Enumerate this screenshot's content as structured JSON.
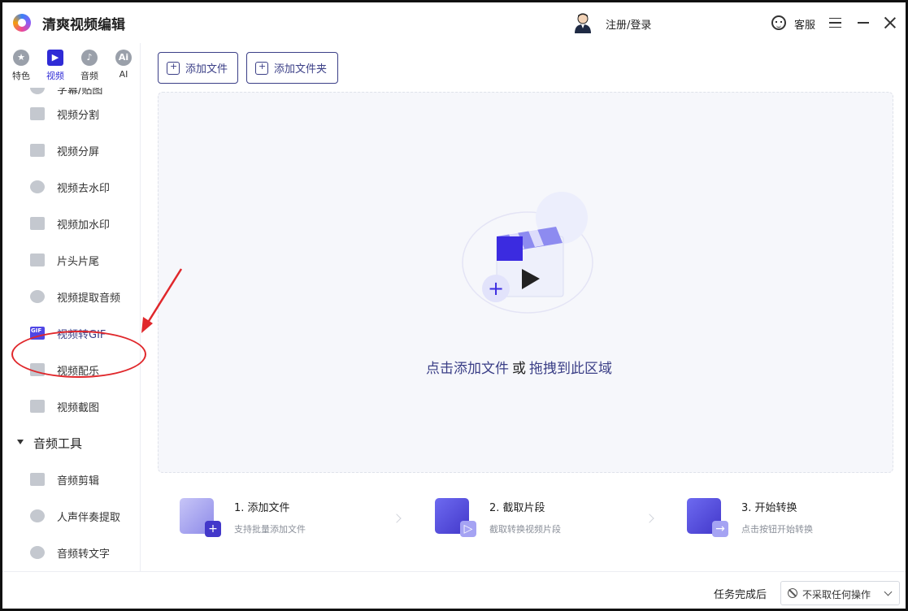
{
  "app": {
    "title": "清爽视频编辑"
  },
  "header": {
    "login_label": "注册/登录",
    "service_label": "客服"
  },
  "category_tabs": [
    {
      "label": "特色",
      "icon": "star-icon",
      "active": false
    },
    {
      "label": "视频",
      "icon": "film-icon",
      "active": true
    },
    {
      "label": "音频",
      "icon": "music-icon",
      "active": false
    },
    {
      "label": "AI",
      "icon": "ai-icon",
      "active": false
    }
  ],
  "tools": [
    {
      "label": "字幕/贴图",
      "icon": "subtitle-icon"
    },
    {
      "label": "视频分割",
      "icon": "split-icon"
    },
    {
      "label": "视频分屏",
      "icon": "split-screen-icon"
    },
    {
      "label": "视频去水印",
      "icon": "remove-watermark-icon"
    },
    {
      "label": "视频加水印",
      "icon": "add-watermark-icon"
    },
    {
      "label": "片头片尾",
      "icon": "intro-outro-icon"
    },
    {
      "label": "视频提取音频",
      "icon": "extract-audio-icon"
    },
    {
      "label": "视频转GIF",
      "icon": "gif-icon"
    },
    {
      "label": "视频配乐",
      "icon": "background-music-icon"
    },
    {
      "label": "视频截图",
      "icon": "screenshot-icon"
    }
  ],
  "audio_section": {
    "title": "音频工具",
    "items": [
      {
        "label": "音频剪辑",
        "icon": "audio-cut-icon"
      },
      {
        "label": "人声伴奏提取",
        "icon": "vocal-extract-icon"
      },
      {
        "label": "音频转文字",
        "icon": "speech-to-text-icon"
      }
    ]
  },
  "toolbar": {
    "add_file_label": "添加文件",
    "add_folder_label": "添加文件夹"
  },
  "dropzone": {
    "hint_add": "点击添加文件",
    "hint_or": "或",
    "hint_drag": "拖拽到此区域"
  },
  "steps": [
    {
      "title": "1. 添加文件",
      "desc": "支持批量添加文件"
    },
    {
      "title": "2. 截取片段",
      "desc": "截取转换视频片段"
    },
    {
      "title": "3. 开始转换",
      "desc": "点击按钮开始转换"
    }
  ],
  "bottom": {
    "task_label": "任务完成后",
    "action_value": "不采取任何操作"
  },
  "colors": {
    "accent": "#3b3f87",
    "brand_purple": "#4f46e5",
    "annotation_red": "#e0272b"
  }
}
